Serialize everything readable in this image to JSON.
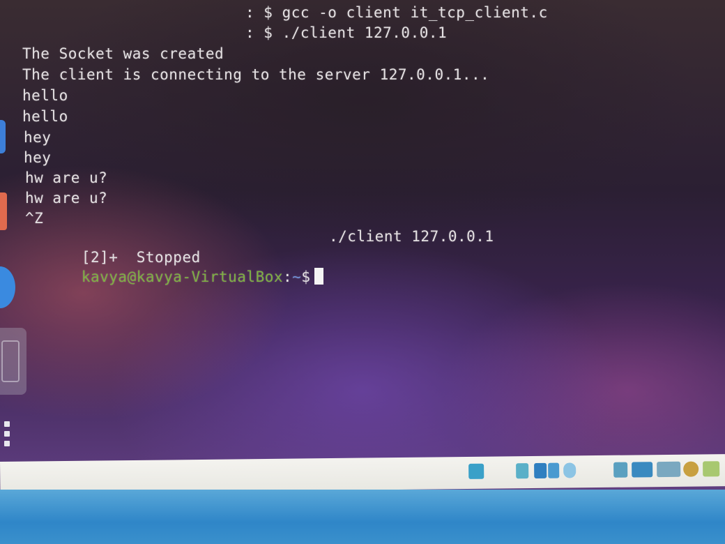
{
  "terminal": {
    "lines": [
      ": $ gcc -o client it_tcp_client.c",
      ": $ ./client 127.0.0.1",
      "The Socket was created",
      "The client is connecting to the server 127.0.0.1...",
      "hello",
      "hello",
      "hey",
      "hey",
      "hw are u?",
      "hw are u?",
      "^Z"
    ],
    "job": {
      "id": "[2]+",
      "state": "Stopped",
      "command": "./client 127.0.0.1"
    },
    "prompt": {
      "user_host": "kavya@kavya-VirtualBox",
      "separator": ":",
      "path": "~",
      "symbol": "$"
    }
  },
  "colors": {
    "prompt_user": "#7fb043",
    "prompt_path": "#6f8fd6",
    "text": "#e4e0e2",
    "statusbar": "#f0efea",
    "host_taskbar": "#3a90cc"
  },
  "dock": {
    "items": [
      "files-icon",
      "software-icon",
      "help-icon",
      "trash-icon",
      "show-apps-icon"
    ]
  },
  "statusbar": {
    "icons": [
      "hard-disk-icon",
      "optical-drive-icon",
      "network-icon",
      "usb-icon",
      "shared-folders-icon",
      "display-icon",
      "recording-icon",
      "mouse-integration-icon",
      "keyboard-icon"
    ]
  }
}
